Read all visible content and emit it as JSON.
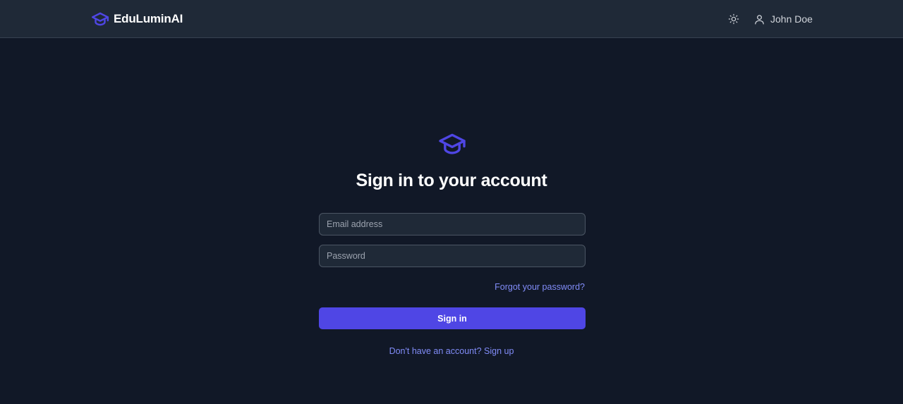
{
  "navbar": {
    "brand": {
      "name": "EduLuminAI",
      "icon": "graduation-cap-icon",
      "icon_color": "#4f46e5"
    },
    "theme_toggle": {
      "icon": "sun-icon"
    },
    "user": {
      "icon": "user-icon",
      "name": "John Doe"
    }
  },
  "signin": {
    "logo_icon": "graduation-cap-icon",
    "title": "Sign in to your account",
    "email": {
      "value": "",
      "placeholder": "Email address"
    },
    "password": {
      "value": "",
      "placeholder": "Password"
    },
    "forgot_password_label": "Forgot your password?",
    "submit_label": "Sign in",
    "signup_label": "Don't have an account? Sign up"
  },
  "colors": {
    "background": "#111827",
    "navbar": "#1f2937",
    "accent": "#4f46e5",
    "link": "#818cf8"
  }
}
